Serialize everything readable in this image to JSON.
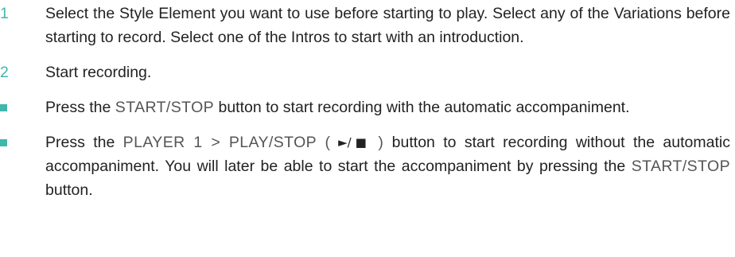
{
  "steps": [
    {
      "number": "1",
      "text": "Select the Style Element you want to use before starting to play. Select any of the Variations before starting to record. Select one of the Intros to start with an introduction."
    },
    {
      "number": "2",
      "text": "Start recording."
    }
  ],
  "bullets": [
    {
      "pre": "Press the ",
      "kw1": "START/STOP",
      "post": " button to start recording with the automatic accompaniment."
    },
    {
      "pre": "Press the ",
      "kw1": "PLAYER 1 > PLAY/STOP (",
      "symbol": " ►/■ ",
      "kw1_close": ")",
      "mid": " button to start recording without the automatic accompaniment. You will later be able to start the accompaniment by pressing the ",
      "kw2": "START/STOP",
      "post": " button."
    }
  ],
  "colors": {
    "accent": "#3fb7ad",
    "text": "#222222",
    "keyword": "#555555"
  }
}
